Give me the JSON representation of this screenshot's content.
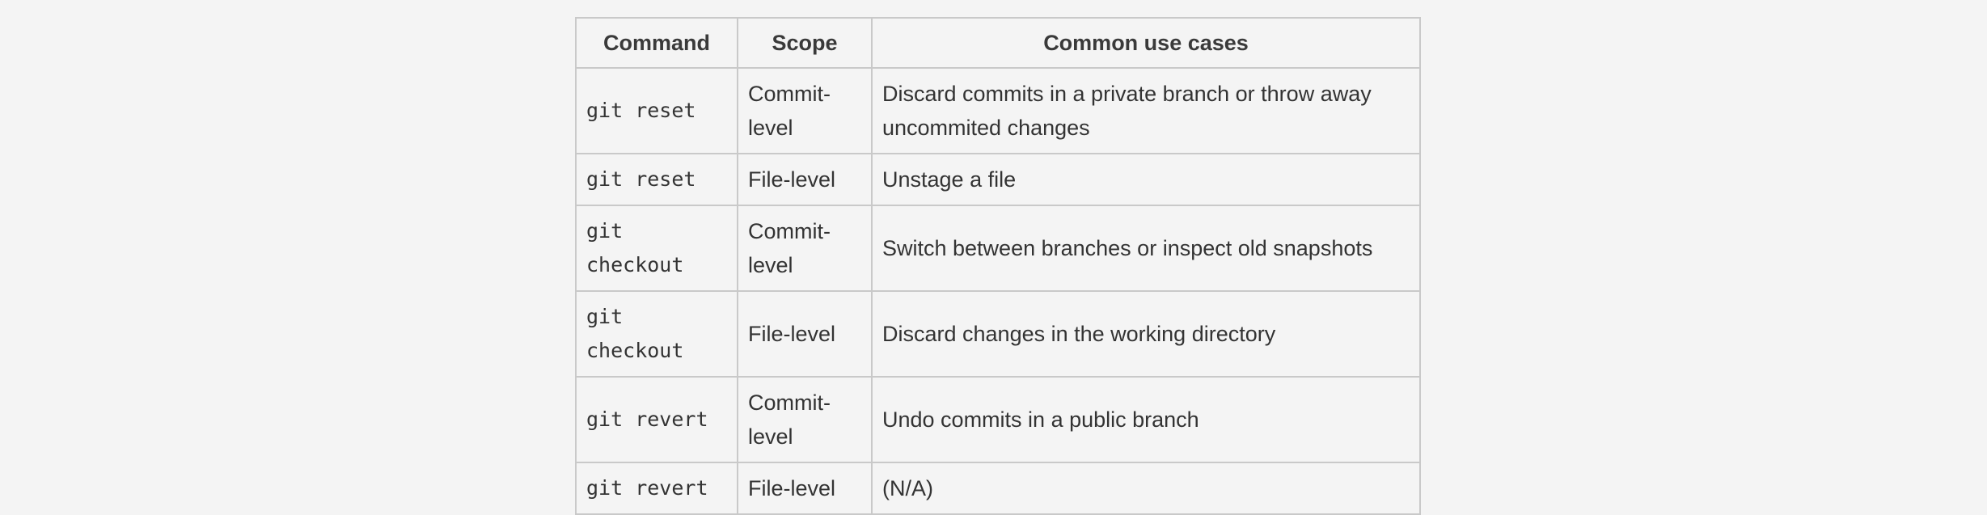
{
  "table": {
    "headers": [
      "Command",
      "Scope",
      "Common use cases"
    ],
    "rows": [
      {
        "command": "git reset",
        "scope": "Commit-level",
        "use_case": "Discard commits in a private branch or throw away uncommited changes"
      },
      {
        "command": "git reset",
        "scope": "File-level",
        "use_case": "Unstage a file"
      },
      {
        "command": "git checkout",
        "scope": "Commit-level",
        "use_case": "Switch between branches or inspect old snapshots"
      },
      {
        "command": "git checkout",
        "scope": "File-level",
        "use_case": "Discard changes in the working directory"
      },
      {
        "command": "git revert",
        "scope": "Commit-level",
        "use_case": "Undo commits in a public branch"
      },
      {
        "command": "git revert",
        "scope": "File-level",
        "use_case": "(N/A)"
      }
    ]
  }
}
